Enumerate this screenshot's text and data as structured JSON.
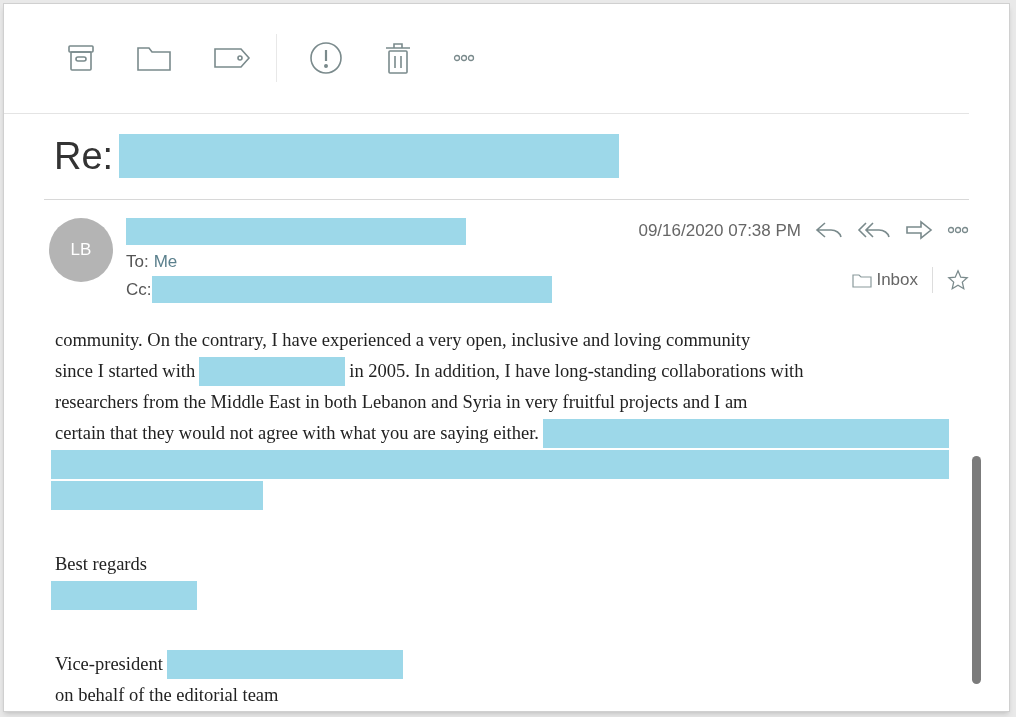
{
  "toolbar": {
    "groups": [
      [
        {
          "kind": "archive"
        },
        {
          "kind": "folder"
        },
        {
          "kind": "tag"
        }
      ],
      [
        {
          "kind": "alert"
        },
        {
          "kind": "trash"
        },
        {
          "kind": "more"
        }
      ]
    ]
  },
  "subject": {
    "prefix": "Re:"
  },
  "message": {
    "avatar": "LB",
    "to_label": "To:",
    "to_value": "Me",
    "cc_label": "Cc:",
    "date": "09/16/2020 07:38 PM",
    "folder": "Inbox",
    "starred": false
  },
  "body": [
    {
      "lines": [
        [
          {
            "kind": "text",
            "text": "community. On the contrary, I have experienced a very open, inclusive and loving community"
          }
        ],
        [
          {
            "kind": "text",
            "text": "since I started with"
          },
          {
            "kind": "shortbar"
          },
          {
            "kind": "text",
            "text": "in 2005. In addition, I have long-standing collaborations with"
          }
        ],
        [
          {
            "kind": "text",
            "text": "researchers from the Middle East in both Lebanon and Syria in very fruitful projects and I am"
          }
        ],
        [
          {
            "kind": "text",
            "text": "certain that they would not agree with what you are saying either."
          },
          {
            "kind": "tailbar"
          }
        ],
        [
          {
            "kind": "fullbar"
          }
        ],
        [
          {
            "kind": "midbar"
          }
        ]
      ]
    },
    {
      "lines": [
        [
          {
            "kind": "text",
            "text": "Best regards"
          }
        ],
        [
          {
            "kind": "shortbar"
          }
        ]
      ]
    },
    {
      "lines": [
        [
          {
            "kind": "text",
            "text": "Vice-president"
          },
          {
            "kind": "longbar"
          }
        ],
        [
          {
            "kind": "text",
            "text": "on behalf of the editorial team"
          }
        ]
      ]
    }
  ]
}
